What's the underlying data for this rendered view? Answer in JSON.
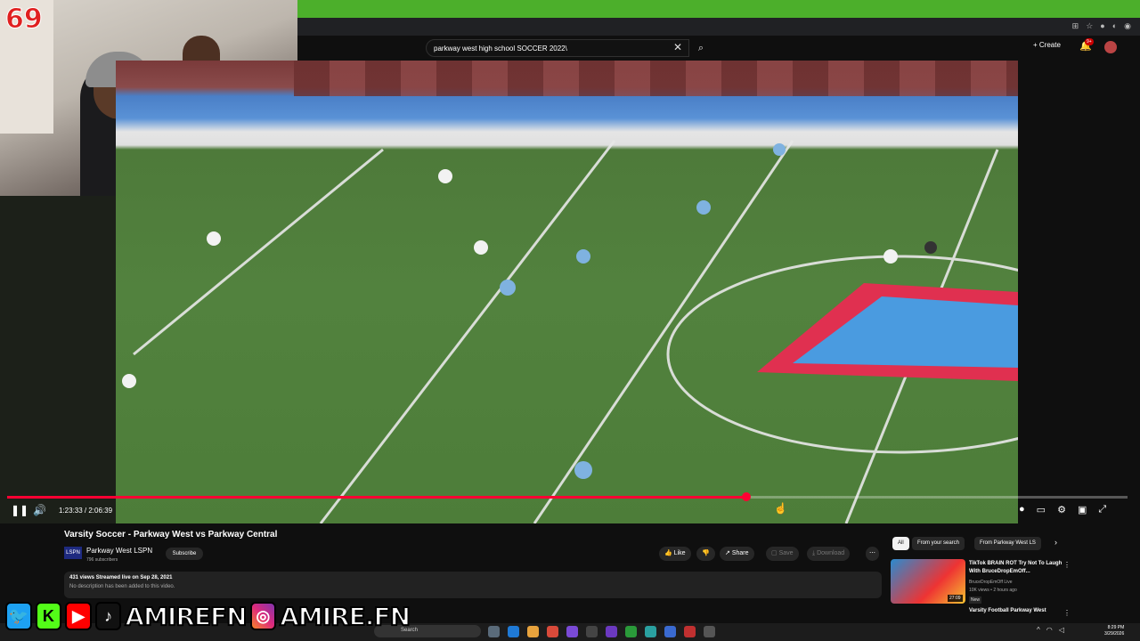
{
  "overlay": {
    "counter": "69",
    "social_handles": [
      "AMIREFN",
      "AMIRE.FN"
    ],
    "social_icons": [
      "twitter-icon",
      "kick-icon",
      "youtube-icon",
      "tiktok-icon",
      "instagram-icon"
    ]
  },
  "search": {
    "query": "parkway west high school SOCCER 2022\\"
  },
  "header": {
    "create_label": "Create",
    "notifications_badge": "9+"
  },
  "player": {
    "timecode": "1:23:33 / 2:06:39",
    "progress": 0.66
  },
  "video": {
    "title": "Varsity Soccer - Parkway West vs Parkway Central",
    "channel_logo": "LSPN",
    "channel_name": "Parkway West LSPN",
    "channel_subs": "796 subscribers",
    "subscribe_label": "Subscribe",
    "like_label": "Like",
    "share_label": "Share",
    "save_label": "Save",
    "download_label": "Download",
    "views_line": "431 views  Streamed live on Sep 28, 2021",
    "description": "No description has been added to this video."
  },
  "sidebar": {
    "chips": [
      "All",
      "From your search",
      "From Parkway West LS"
    ],
    "recommendations": [
      {
        "title": "TikTok BRAIN ROT Try Not To Laugh With BruceDropEmOff...",
        "channel": "BruceDropEmOff Live",
        "meta": "10K views • 2 hours ago",
        "badge": "New",
        "duration": "27:09"
      },
      {
        "title": "Varsity Football Parkway West"
      }
    ]
  },
  "taskbar": {
    "search_placeholder": "Search",
    "time": "8:29 PM",
    "date": "3/29/2026"
  },
  "colors": {
    "progress": "#ff0033",
    "title_bar": "#4caf2b",
    "background": "#0f0f0f"
  }
}
